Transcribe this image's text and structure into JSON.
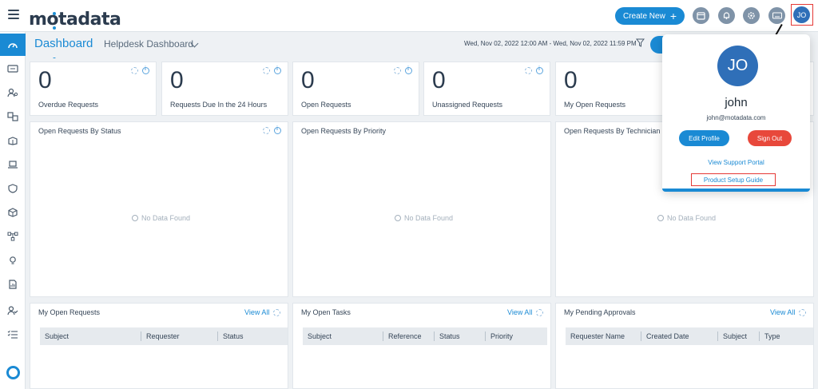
{
  "app": {
    "logo_text": "motadata"
  },
  "topbar": {
    "create_label": "Create New",
    "create_plus": "+",
    "icons": [
      "calendar-icon",
      "bell-icon",
      "settings-icon",
      "keyboard-icon"
    ],
    "avatar_initials": "JO"
  },
  "header": {
    "title": "Dashboard",
    "dashboard_select": "Helpdesk Dashboard",
    "date_range": "Wed, Nov 02, 2022 12:00 AM - Wed, Nov 02, 2022 11:59 PM"
  },
  "stats": [
    {
      "value": "0",
      "label": "Overdue Requests"
    },
    {
      "value": "0",
      "label": "Requests Due In the 24 Hours"
    },
    {
      "value": "0",
      "label": "Open Requests"
    },
    {
      "value": "0",
      "label": "Unassigned Requests"
    },
    {
      "value": "0",
      "label": "My Open Requests"
    }
  ],
  "panels": [
    {
      "title": "Open Requests By Status",
      "empty": "No Data Found"
    },
    {
      "title": "Open Requests By Priority",
      "empty": "No Data Found"
    },
    {
      "title": "Open Requests By Technician",
      "empty": "No Data Found"
    }
  ],
  "tables": [
    {
      "title": "My Open Requests",
      "view_all": "View All",
      "columns": [
        "Subject",
        "Requester",
        "Status"
      ]
    },
    {
      "title": "My Open Tasks",
      "view_all": "View All",
      "columns": [
        "Subject",
        "Reference",
        "Status",
        "Priority"
      ]
    },
    {
      "title": "My Pending Approvals",
      "view_all": "View All",
      "columns": [
        "Requester Name",
        "Created Date",
        "Subject",
        "Type"
      ]
    }
  ],
  "profile": {
    "initials": "JO",
    "name": "john",
    "email": "john@motadata.com",
    "edit_label": "Edit Profile",
    "signout_label": "Sign Out",
    "support_label": "View Support Portal",
    "guide_label": "Product Setup Guide"
  },
  "colors": {
    "accent": "#1a8ad4",
    "danger": "#e8483b",
    "highlight": "#e53935"
  }
}
